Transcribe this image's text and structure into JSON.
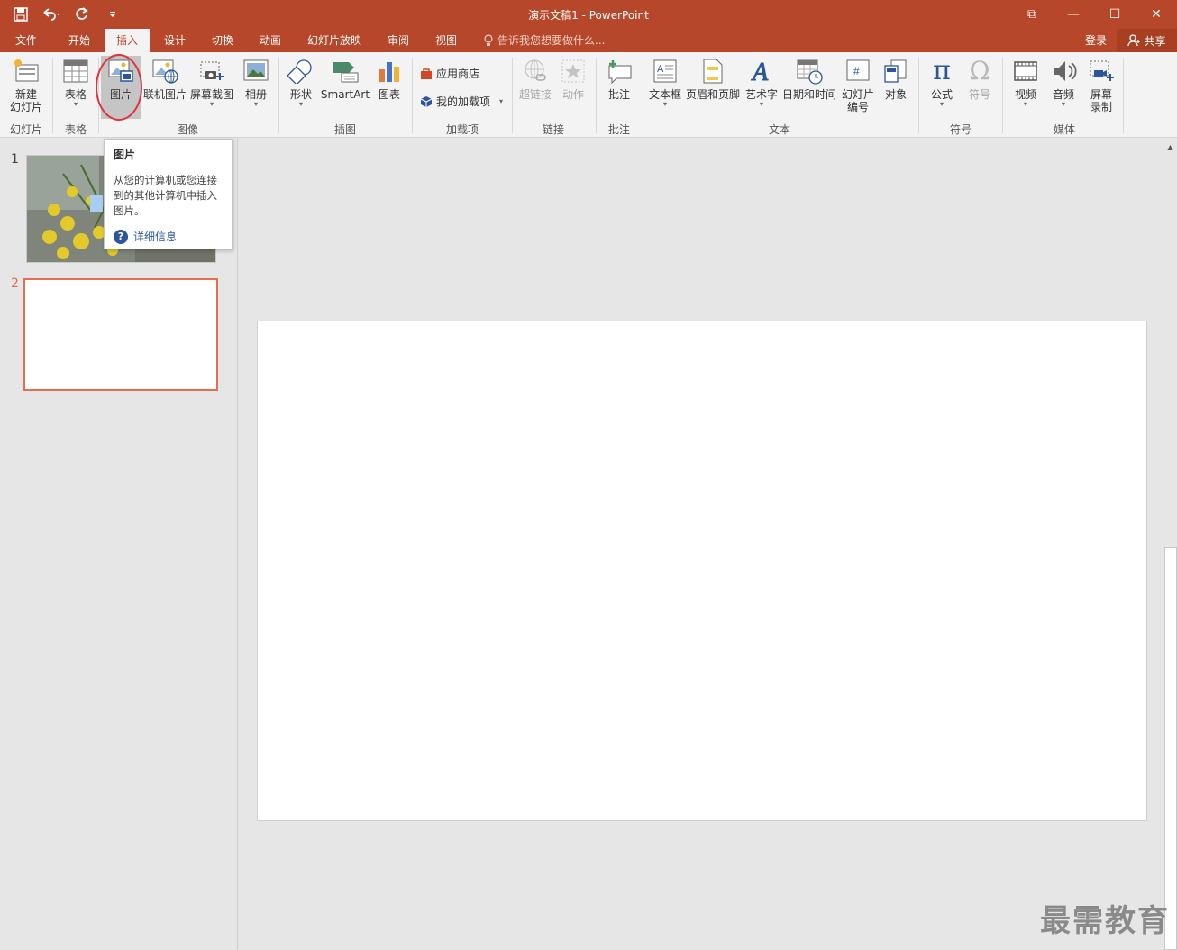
{
  "window": {
    "title": "演示文稿1 - PowerPoint",
    "restore_label": "⧉",
    "minimize_label": "—",
    "maximize_label": "☐",
    "close_label": "✕"
  },
  "tabs": [
    {
      "label": "文件"
    },
    {
      "label": "开始"
    },
    {
      "label": "插入"
    },
    {
      "label": "设计"
    },
    {
      "label": "切换"
    },
    {
      "label": "动画"
    },
    {
      "label": "幻灯片放映"
    },
    {
      "label": "审阅"
    },
    {
      "label": "视图"
    }
  ],
  "tell_me": "告诉我您想要做什么...",
  "account": {
    "signin": "登录",
    "share": "共享"
  },
  "ribbon": {
    "new_slide": "新建\n幻灯片",
    "table": "表格",
    "pictures": "图片",
    "online_pictures": "联机图片",
    "screenshot": "屏幕截图",
    "photo_album": "相册",
    "shapes": "形状",
    "smartart": "SmartArt",
    "chart": "图表",
    "store": "应用商店",
    "my_addins": "我的加载项",
    "hyperlink": "超链接",
    "action": "动作",
    "comment": "批注",
    "textbox": "文本框",
    "header_footer": "页眉和页脚",
    "wordart": "艺术字",
    "datetime": "日期和时间",
    "slide_number": "幻灯片\n编号",
    "object": "对象",
    "equation": "公式",
    "symbol": "符号",
    "video": "视频",
    "audio": "音频",
    "screen_recording": "屏幕\n录制",
    "groups": {
      "slides": "幻灯片",
      "tables": "表格",
      "images": "图像",
      "illustrations": "插图",
      "addins": "加载项",
      "links": "链接",
      "comments": "批注",
      "text": "文本",
      "symbols": "符号",
      "media": "媒体"
    }
  },
  "tooltip": {
    "title": "图片",
    "body": "从您的计算机或您连接到的其他计算机中插入图片。",
    "link": "详细信息"
  },
  "slides": [
    {
      "number": "1"
    },
    {
      "number": "2"
    }
  ],
  "watermark": "最需教育",
  "colors": {
    "accent": "#b7472a",
    "selection": "#e56e50"
  }
}
